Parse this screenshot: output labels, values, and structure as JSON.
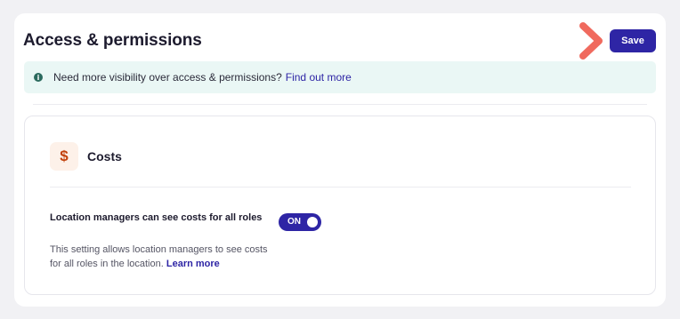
{
  "header": {
    "title": "Access & permissions",
    "save_label": "Save"
  },
  "banner": {
    "icon": "info-icon",
    "text": "Need more visibility over access & permissions?",
    "link_text": "Find out more"
  },
  "costs": {
    "icon": "dollar-icon",
    "icon_glyph": "$",
    "title": "Costs",
    "setting": {
      "title": "Location managers can see costs for all roles",
      "description": "This setting allows location managers to see costs for all roles in the location.",
      "link_text": "Learn more",
      "toggle_label": "ON",
      "enabled": true
    }
  },
  "colors": {
    "accent": "#2e25a5",
    "banner_bg": "#eaf7f5",
    "pointer": "#f06a5e"
  }
}
